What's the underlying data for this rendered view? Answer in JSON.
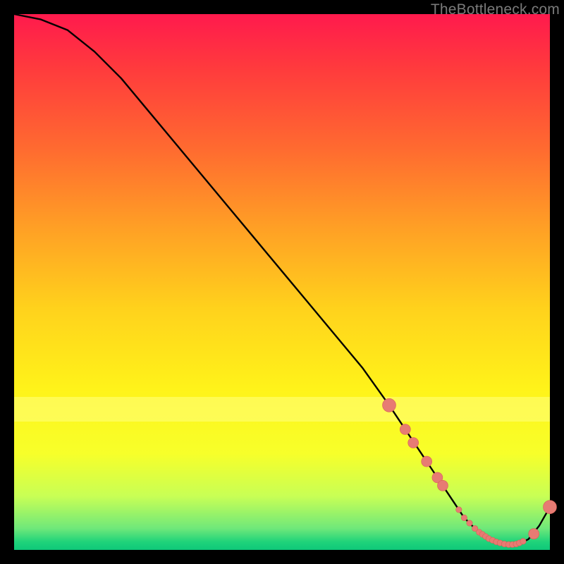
{
  "watermark": "TheBottleneck.com",
  "colors": {
    "background": "#000000",
    "curve_stroke": "#000000",
    "marker_fill": "#e77b73",
    "marker_stroke": "#d85f56",
    "gradient_top": "#ff1a4d",
    "gradient_bottom": "#0fc879"
  },
  "chart_data": {
    "type": "line",
    "x": [
      0,
      5,
      10,
      15,
      20,
      25,
      30,
      35,
      40,
      45,
      50,
      55,
      60,
      65,
      70,
      72,
      74,
      76,
      78,
      80,
      82,
      84,
      86,
      88,
      90,
      92,
      94,
      96,
      98,
      100
    ],
    "values": [
      100,
      99,
      97,
      93,
      88,
      82,
      76,
      70,
      64,
      58,
      52,
      46,
      40,
      34,
      27,
      24,
      21,
      18,
      15,
      12,
      9,
      6,
      4,
      2.5,
      1.5,
      1,
      1,
      2,
      4.5,
      8
    ],
    "title": "",
    "xlabel": "",
    "ylabel": "",
    "xlim": [
      0,
      100
    ],
    "ylim": [
      0,
      100
    ],
    "markers": {
      "large": [
        {
          "x": 70,
          "y": 27
        },
        {
          "x": 100,
          "y": 8
        }
      ],
      "medium": [
        {
          "x": 73,
          "y": 22.5
        },
        {
          "x": 74.5,
          "y": 20
        },
        {
          "x": 77,
          "y": 16.5
        },
        {
          "x": 79,
          "y": 13.5
        },
        {
          "x": 80,
          "y": 12
        },
        {
          "x": 97,
          "y": 3
        }
      ],
      "small": [
        {
          "x": 83,
          "y": 7.5
        },
        {
          "x": 84,
          "y": 6
        },
        {
          "x": 85,
          "y": 5
        },
        {
          "x": 86,
          "y": 4
        },
        {
          "x": 86.8,
          "y": 3.3
        },
        {
          "x": 87.4,
          "y": 2.9
        },
        {
          "x": 88,
          "y": 2.5
        },
        {
          "x": 88.6,
          "y": 2.1
        },
        {
          "x": 89.3,
          "y": 1.8
        },
        {
          "x": 90,
          "y": 1.5
        },
        {
          "x": 90.7,
          "y": 1.3
        },
        {
          "x": 91.5,
          "y": 1.1
        },
        {
          "x": 92.3,
          "y": 1.0
        },
        {
          "x": 93,
          "y": 1.0
        },
        {
          "x": 93.7,
          "y": 1.1
        },
        {
          "x": 94.3,
          "y": 1.3
        },
        {
          "x": 95,
          "y": 1.6
        }
      ]
    }
  }
}
